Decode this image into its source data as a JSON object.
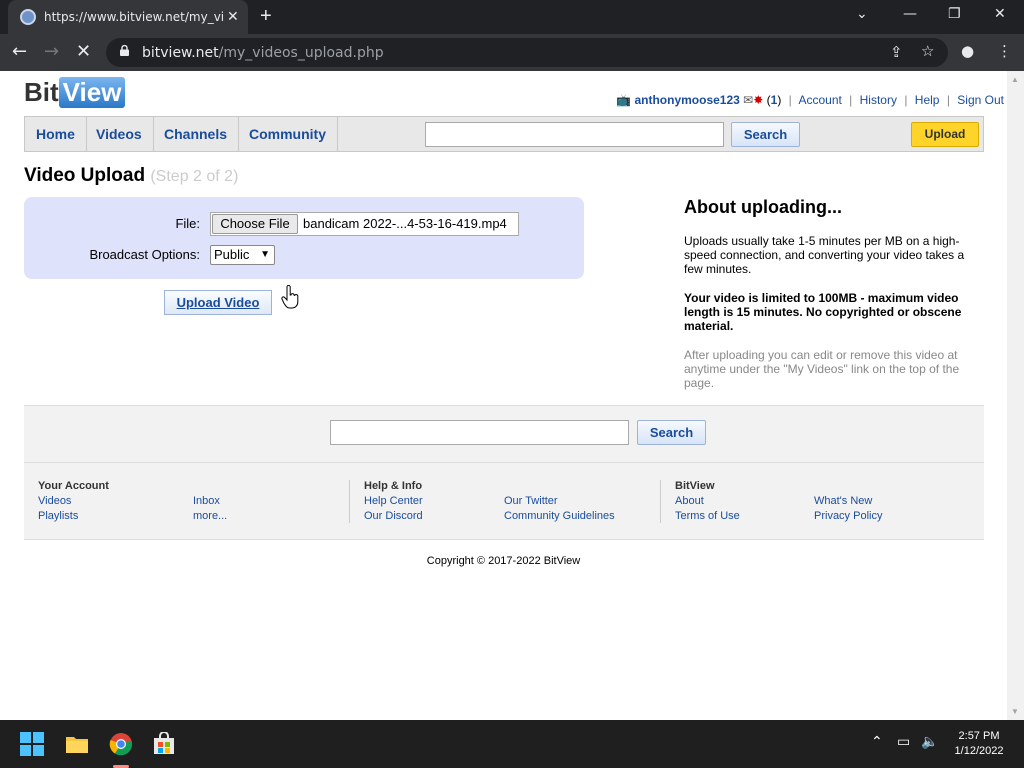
{
  "browser": {
    "tab_title": "https://www.bitview.net/my_vide",
    "url_domain": "bitview.net",
    "url_path": "/my_videos_upload.php"
  },
  "site": {
    "logo_bit": "Bit",
    "logo_view": "View",
    "user": {
      "username": "anthonymoose123",
      "mail_count": "1",
      "links": [
        "Account",
        "History",
        "Help",
        "Sign Out"
      ]
    },
    "nav": [
      "Home",
      "Videos",
      "Channels",
      "Community"
    ],
    "search_button": "Search",
    "upload_button": "Upload"
  },
  "upload": {
    "title": "Video Upload",
    "step": "(Step 2 of 2)",
    "file_label": "File:",
    "choose_file": "Choose File",
    "file_name": "bandicam 2022-...4-53-16-419.mp4",
    "broadcast_label": "Broadcast Options:",
    "broadcast_value": "Public",
    "submit": "Upload Video"
  },
  "about": {
    "title": "About uploading...",
    "p1": "Uploads usually take 1-5 minutes per MB on a high-speed connection, and converting your video takes a few minutes.",
    "p2": "Your video is limited to 100MB - maximum video length is 15 minutes. No copyrighted or obscene material.",
    "p3": "After uploading you can edit or remove this video at anytime under the \"My Videos\" link on the top of the page."
  },
  "footer": {
    "search_button": "Search",
    "col1_title": "Your Account",
    "col1_links": [
      "Videos",
      "Playlists",
      "Inbox",
      "more..."
    ],
    "col2_title": "Help & Info",
    "col2_links": [
      "Help Center",
      "Our Discord",
      "Our Twitter",
      "Community Guidelines"
    ],
    "col3_title": "BitView",
    "col3_links": [
      "About",
      "Terms of Use",
      "What's New",
      "Privacy Policy"
    ],
    "copyright": "Copyright © 2017-2022 BitView"
  },
  "taskbar": {
    "time": "2:57 PM",
    "date": "1/12/2022"
  },
  "colors": {
    "link": "#1a4c9c",
    "upload_yellow": "#ffd42a",
    "form_bg": "#dfe2fb"
  }
}
